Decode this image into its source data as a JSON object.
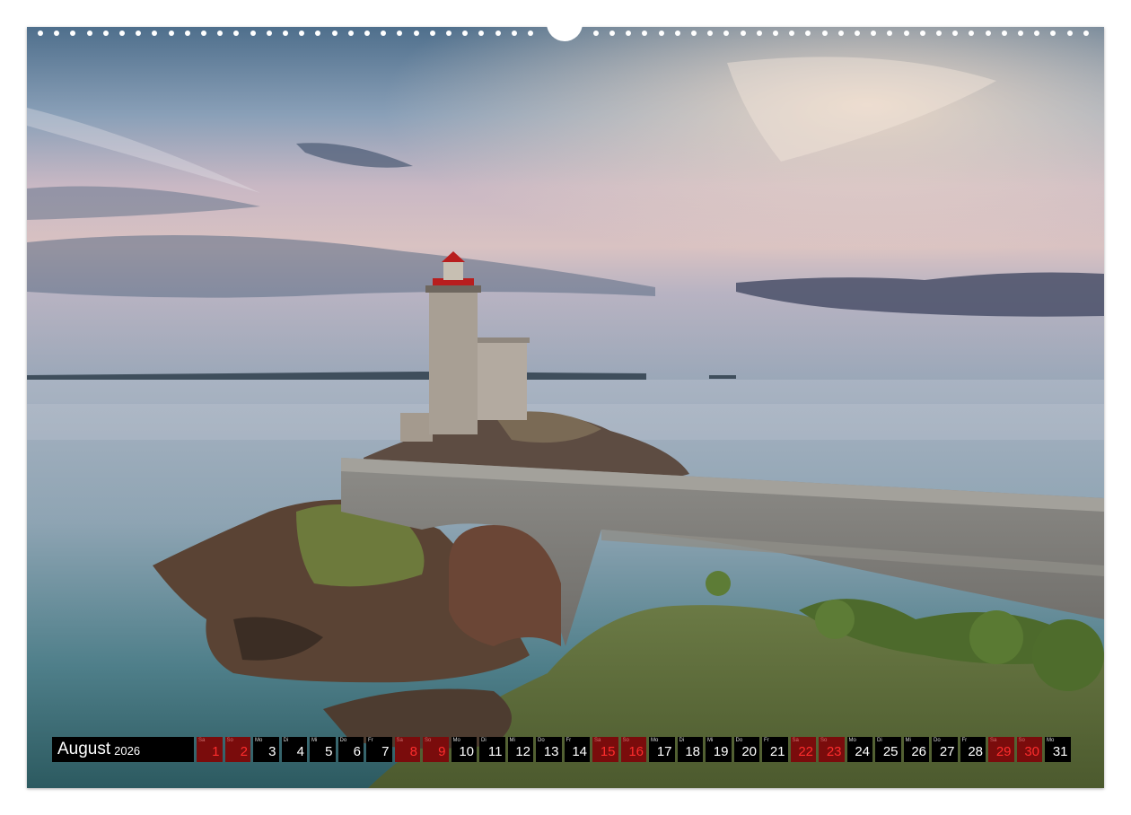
{
  "calendar": {
    "month": "August",
    "year": "2026",
    "days": [
      {
        "wd": "Sa",
        "num": "1",
        "weekend": true
      },
      {
        "wd": "So",
        "num": "2",
        "weekend": true
      },
      {
        "wd": "Mo",
        "num": "3",
        "weekend": false
      },
      {
        "wd": "Di",
        "num": "4",
        "weekend": false
      },
      {
        "wd": "Mi",
        "num": "5",
        "weekend": false
      },
      {
        "wd": "Do",
        "num": "6",
        "weekend": false
      },
      {
        "wd": "Fr",
        "num": "7",
        "weekend": false
      },
      {
        "wd": "Sa",
        "num": "8",
        "weekend": true
      },
      {
        "wd": "So",
        "num": "9",
        "weekend": true
      },
      {
        "wd": "Mo",
        "num": "10",
        "weekend": false
      },
      {
        "wd": "Di",
        "num": "11",
        "weekend": false
      },
      {
        "wd": "Mi",
        "num": "12",
        "weekend": false
      },
      {
        "wd": "Do",
        "num": "13",
        "weekend": false
      },
      {
        "wd": "Fr",
        "num": "14",
        "weekend": false
      },
      {
        "wd": "Sa",
        "num": "15",
        "weekend": true
      },
      {
        "wd": "So",
        "num": "16",
        "weekend": true
      },
      {
        "wd": "Mo",
        "num": "17",
        "weekend": false
      },
      {
        "wd": "Di",
        "num": "18",
        "weekend": false
      },
      {
        "wd": "Mi",
        "num": "19",
        "weekend": false
      },
      {
        "wd": "Do",
        "num": "20",
        "weekend": false
      },
      {
        "wd": "Fr",
        "num": "21",
        "weekend": false
      },
      {
        "wd": "Sa",
        "num": "22",
        "weekend": true
      },
      {
        "wd": "So",
        "num": "23",
        "weekend": true
      },
      {
        "wd": "Mo",
        "num": "24",
        "weekend": false
      },
      {
        "wd": "Di",
        "num": "25",
        "weekend": false
      },
      {
        "wd": "Mi",
        "num": "26",
        "weekend": false
      },
      {
        "wd": "Do",
        "num": "27",
        "weekend": false
      },
      {
        "wd": "Fr",
        "num": "28",
        "weekend": false
      },
      {
        "wd": "Sa",
        "num": "29",
        "weekend": true
      },
      {
        "wd": "So",
        "num": "30",
        "weekend": true
      },
      {
        "wd": "Mo",
        "num": "31",
        "weekend": false
      }
    ]
  },
  "colors": {
    "weekend_bg": "#7a0c0c",
    "weekend_text": "#ff2d2d",
    "weekday_bg": "#000000",
    "weekday_text": "#ffffff"
  }
}
